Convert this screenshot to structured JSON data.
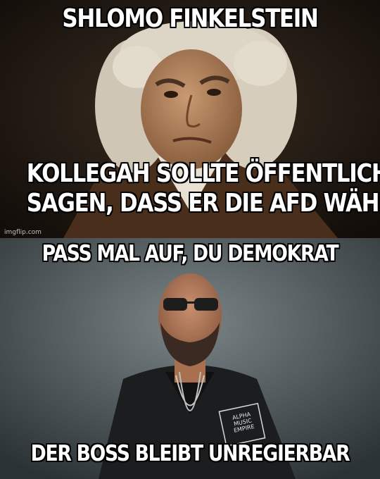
{
  "panels": [
    {
      "top_text": "SHLOMO FINKELSTEIN",
      "bottom_text": [
        "KOLLEGAH SOLLTE ÖFFENTLICH",
        "SAGEN, DASS ER DIE AFD WÄHLT"
      ],
      "watermark": "imgflip.com"
    },
    {
      "top_text": "PASS MAL AUF, DU DEMOKRAT",
      "bottom_text": "DER BOSS BLEIBT UNREGIERBAR",
      "jacket_patch": [
        "ALPHA",
        "MUSIC",
        "EMPIRE"
      ]
    }
  ]
}
